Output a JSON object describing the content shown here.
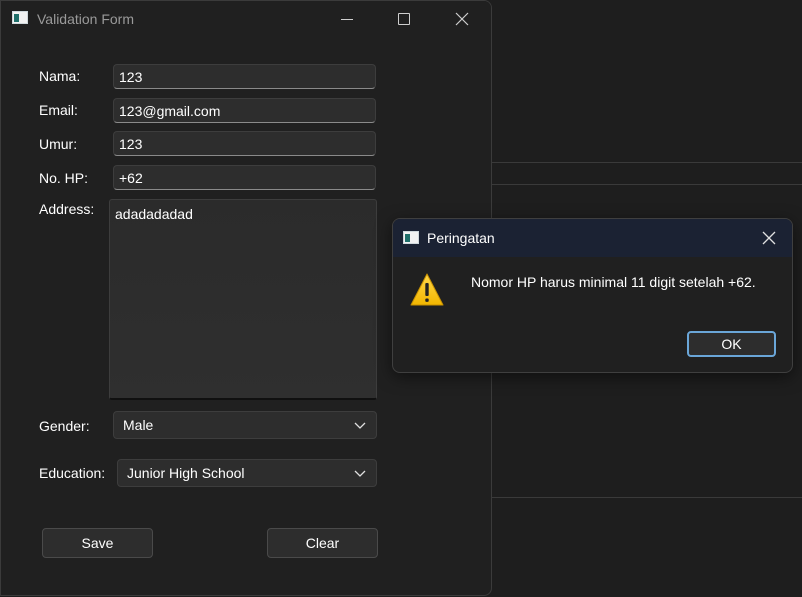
{
  "window": {
    "title": "Validation Form"
  },
  "form": {
    "nama_label": "Nama:",
    "nama_value": "123",
    "email_label": "Email:",
    "email_value": "123@gmail.com",
    "umur_label": "Umur:",
    "umur_value": "123",
    "hp_label": "No. HP:",
    "hp_value": "+62",
    "address_label": "Address:",
    "address_value": "adadadadad",
    "gender_label": "Gender:",
    "gender_value": "Male",
    "education_label": "Education:",
    "education_value": "Junior High School",
    "save_label": "Save",
    "clear_label": "Clear"
  },
  "dialog": {
    "title": "Peringatan",
    "message": "Nomor HP harus minimal 11 digit setelah +62.",
    "ok_label": "OK"
  },
  "colors": {
    "window_bg": "#202020",
    "field_bg": "#2d2d2d",
    "dialog_titlebar": "#1b2233",
    "ok_border": "#6aa6d8",
    "warning_yellow": "#f7c600"
  }
}
